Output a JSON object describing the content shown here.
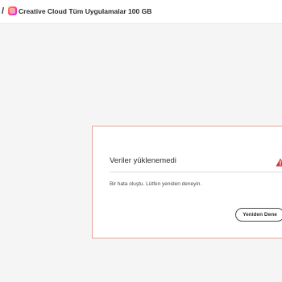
{
  "header": {
    "separator": "/",
    "app_icon": "creative-cloud-icon",
    "title": "Creative Cloud Tüm Uygulamalar 100 GB"
  },
  "dialog": {
    "title": "Veriler yüklenemedi",
    "icon": "alert-icon",
    "message": "Bir hata oluştu. Lütfen yeniden deneyin.",
    "retry_label": "Yeniden Dene"
  },
  "colors": {
    "background": "#f5f5f5",
    "dialog_border": "#e7a39a",
    "alert_red": "#d7373f",
    "text": "#2c2c2c"
  }
}
